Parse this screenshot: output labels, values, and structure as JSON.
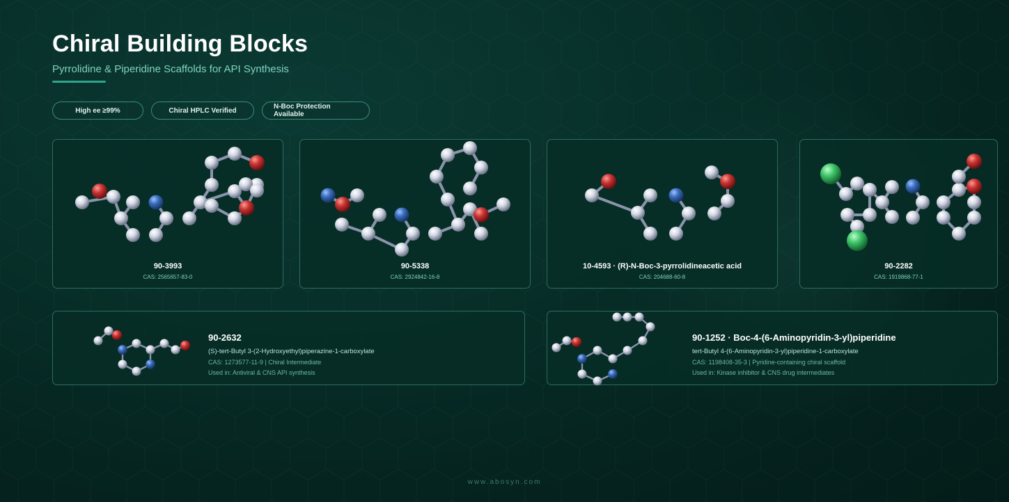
{
  "header": {
    "title": "Chiral Building Blocks",
    "subtitle": "Pyrrolidine & Piperidine Scaffolds for API Synthesis"
  },
  "badges": [
    {
      "label": "High ee ≥99%"
    },
    {
      "label": "Chiral HPLC Verified"
    },
    {
      "label": "N-Boc Protection Available"
    }
  ],
  "cards": [
    {
      "code": "90-3993",
      "cas": "CAS: 2565657-83-0"
    },
    {
      "code": "90-5338",
      "cas": "CAS: 2924842-16-8"
    },
    {
      "code": "10-4593 · (R)-N-Boc-3-pyrrolidineacetic acid",
      "cas": "CAS: 204688-60-8"
    },
    {
      "code": "90-2282",
      "cas": "CAS: 1919868-77-1"
    }
  ],
  "wide_cards": [
    {
      "code": "90-2632",
      "name": "(S)-tert-Butyl 3-(2-Hydroxyethyl)piperazine-1-carboxylate",
      "meta": "CAS: 1273577-11-9  |  Chiral Intermediate",
      "use": "Used in: Antiviral & CNS API synthesis"
    },
    {
      "code": "90-1252 · Boc-4-(6-Aminopyridin-3-yl)piperidine",
      "name": "tert-Butyl 4-(6-Aminopyridin-3-yl)piperidine-1-carboxylate",
      "meta": "CAS: 1198408-35-3  |  Pyridine-containing chiral scaffold",
      "use": "Used in: Kinase inhibitor & CNS drug intermediates"
    }
  ],
  "footer": {
    "text": "www.abosyn.com"
  },
  "colors": {
    "background": "#062b25",
    "accent": "#2fa58c",
    "card_border": "#2c6c5e",
    "atom_carbon": "#d9dde8",
    "atom_oxygen": "#c83232",
    "atom_nitrogen": "#3b6fbf",
    "atom_chlorine": "#3fc46a"
  },
  "icons": [
    "molecule-model-icon"
  ]
}
